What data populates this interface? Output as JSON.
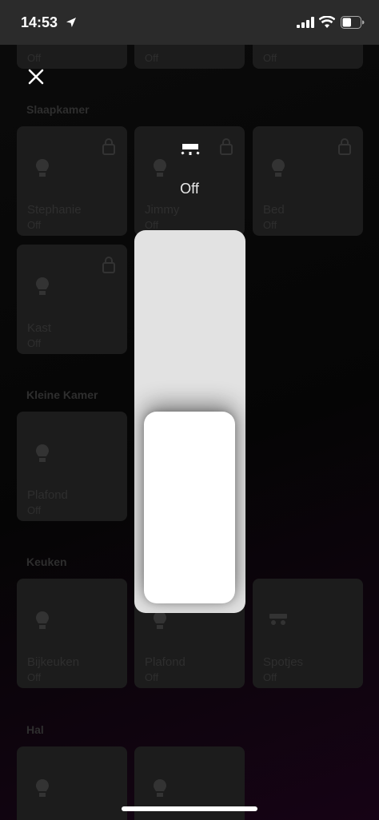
{
  "status_bar": {
    "time": "14:53",
    "battery_level": 0.5
  },
  "background": {
    "top_tiles": [
      {
        "state": "Off"
      },
      {
        "state": "Off"
      },
      {
        "state": "Off"
      }
    ],
    "sections": [
      {
        "title": "Slaapkamer",
        "tiles": [
          {
            "name": "Stephanie",
            "state": "Off",
            "icon": "bulb-icon",
            "locked": true
          },
          {
            "name": "Jimmy",
            "state": "Off",
            "icon": "bulb-icon",
            "locked": true
          },
          {
            "name": "Bed",
            "state": "Off",
            "icon": "bulb-icon",
            "locked": true
          },
          {
            "name": "Kast",
            "state": "Off",
            "icon": "bulb-icon",
            "locked": true
          }
        ]
      },
      {
        "title": "Kleine Kamer",
        "tiles": [
          {
            "name": "Plafond",
            "state": "Off",
            "icon": "bulb-icon",
            "locked": false
          }
        ]
      },
      {
        "title": "Keuken",
        "tiles": [
          {
            "name": "Bijkeuken",
            "state": "Off",
            "icon": "bulb-icon",
            "locked": false
          },
          {
            "name": "Plafond",
            "state": "Off",
            "icon": "bulb-icon",
            "locked": false
          },
          {
            "name": "Spotjes",
            "state": "Off",
            "icon": "spot-icon",
            "locked": false
          }
        ]
      },
      {
        "title": "Hal",
        "tiles": [
          {
            "name": "",
            "state": "",
            "icon": "bulb-icon",
            "locked": false
          },
          {
            "name": "",
            "state": "",
            "icon": "bulb-icon",
            "locked": false
          }
        ]
      }
    ]
  },
  "overlay": {
    "close_icon": "close-icon",
    "device_icon": "ceiling-light-icon",
    "state_label": "Off",
    "brightness": 0.0
  },
  "colors": {
    "status_bar_bg": "#2b2b2b",
    "tile_bg": "#1c1c1c",
    "slider_track": "#e2e2e2",
    "slider_handle": "#ffffff"
  }
}
